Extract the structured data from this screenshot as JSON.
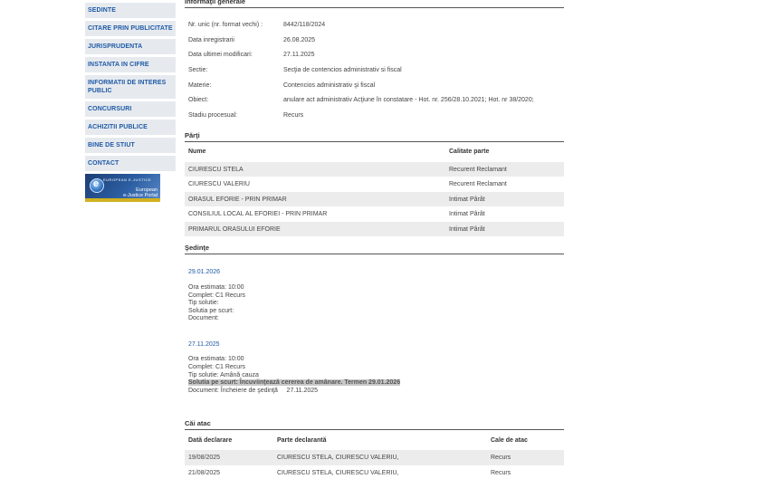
{
  "nav": [
    "SEDINTE",
    "CITARE PRIN PUBLICITATE",
    "JURISPRUDENTA",
    "INSTANTA IN CIFRE",
    "INFORMATII DE INTERES PUBLIC",
    "CONCURSURI",
    "ACHIZITII PUBLICE",
    "BINE DE STIUT",
    "CONTACT"
  ],
  "banner": {
    "top": "EUROPEAN E-JUSTICE",
    "line1": "European",
    "line2": "e-Justice Portal"
  },
  "info": {
    "title": "Informaţii generale",
    "rows": [
      {
        "k": "Nr. unic (nr. format vechi) :",
        "v": "8442/118/2024"
      },
      {
        "k": "Data inregistrarii",
        "v": "26.08.2025"
      },
      {
        "k": "Data ultimei modificari:",
        "v": "27.11.2025"
      },
      {
        "k": "Sectie:",
        "v": "Secţia de contencios administrativ si fiscal"
      },
      {
        "k": "Materie:",
        "v": "Contencios administrativ şi fiscal"
      },
      {
        "k": "Obiect:",
        "v": "anulare act administrativ Acţiune în constatare - Hot. nr. 256/28.10.2021; Hot. nr 38/2020;"
      },
      {
        "k": "Stadiu procesual:",
        "v": "Recurs"
      }
    ]
  },
  "parti": {
    "title": "Părţi",
    "h_nume": "Nume",
    "h_cal": "Calitate parte",
    "rows": [
      {
        "n": "CIURESCU STELA",
        "c": "Recurent Reclamant"
      },
      {
        "n": "CIURESCU VALERIU",
        "c": "Recurent Reclamant"
      },
      {
        "n": "ORASUL EFORIE - PRIN PRIMAR",
        "c": "Intimat Pârât"
      },
      {
        "n": "CONSILIUL LOCAL AL EFORIEI - PRIN PRIMAR",
        "c": "Intimat Pârât"
      },
      {
        "n": "PRIMARUL ORASULUI EFORIE",
        "c": "Intimat Pârât"
      }
    ]
  },
  "sedinte": {
    "title": "Şedinţe",
    "items": [
      {
        "date": "29.01.2026",
        "ora": "Ora estimata: 10:00",
        "complet": "Complet: C1 Recurs",
        "tip": "Tip solutie:",
        "solutia": "Solutia pe scurt:",
        "document": "Document:"
      },
      {
        "date": "27.11.2025",
        "ora": "Ora estimata: 10:00",
        "complet": "Complet: C1 Recurs",
        "tip": "Tip solutie: Amână cauza",
        "solutia": "Solutia pe scurt: Încuviinţează cererea de amânare. Termen 29.01.2026",
        "document": "Document: Încheiere de şedinţă     27.11.2025"
      }
    ]
  },
  "cai": {
    "title": "Căi atac",
    "h_data": "Dată declarare",
    "h_parte": "Parte declarantă",
    "h_cale": "Cale de atac",
    "rows": [
      {
        "d": "19/08/2025",
        "p": "CIURESCU STELA, CIURESCU VALERIU,",
        "c": "Recurs"
      },
      {
        "d": "21/08/2025",
        "p": "CIURESCU STELA, CIURESCU VALERIU,",
        "c": "Recurs"
      }
    ]
  }
}
